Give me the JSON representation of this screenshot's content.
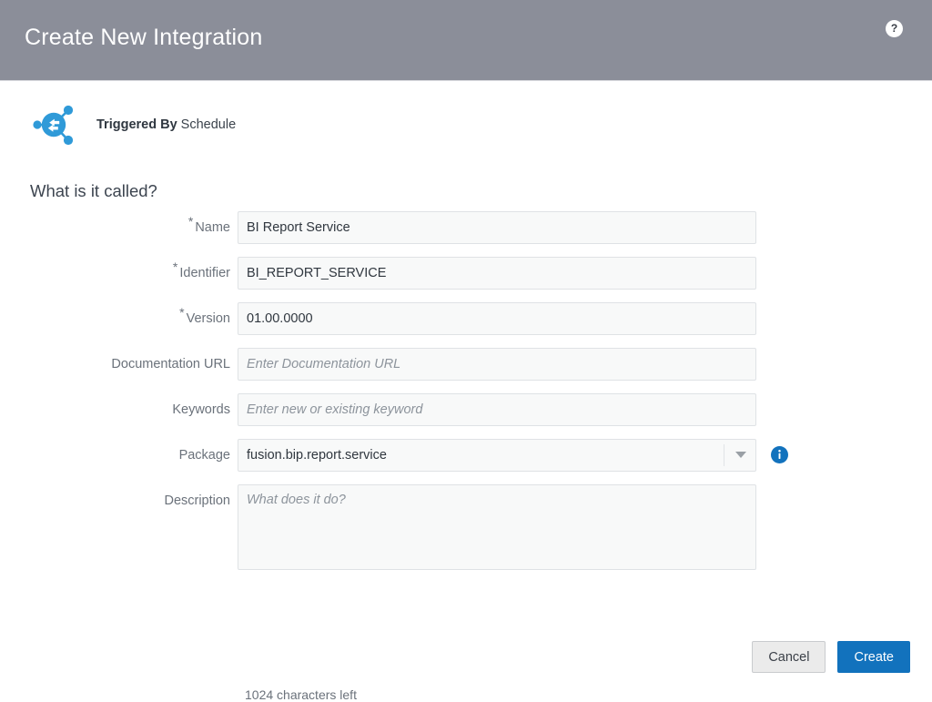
{
  "window": {
    "title": "Create New Integration",
    "help_icon": "question-mark-icon",
    "help_label": "?",
    "header_bg": "#8b8e99"
  },
  "trigger": {
    "icon": "integration-trigger-icon",
    "prefix": "Triggered By",
    "value": "Schedule",
    "accent": "#2f9ad8"
  },
  "section": {
    "heading": "What is it called?"
  },
  "fields": {
    "name": {
      "label": "Name",
      "required": true,
      "required_marker": "*",
      "value": "BI Report Service",
      "placeholder": ""
    },
    "identifier": {
      "label": "Identifier",
      "required": true,
      "required_marker": "*",
      "value": "BI_REPORT_SERVICE",
      "placeholder": ""
    },
    "version": {
      "label": "Version",
      "required": true,
      "required_marker": "*",
      "value": "01.00.0000",
      "placeholder": ""
    },
    "documentation_url": {
      "label": "Documentation URL",
      "required": false,
      "value": "",
      "placeholder": "Enter Documentation URL"
    },
    "keywords": {
      "label": "Keywords",
      "required": false,
      "value": "",
      "placeholder": "Enter new or existing keyword"
    },
    "package": {
      "label": "Package",
      "required": false,
      "value": "fusion.bip.report.service",
      "placeholder": "",
      "options": [
        "fusion.bip.report.service"
      ],
      "dropdown_icon": "chevron-down-icon",
      "info_icon": "info-icon",
      "info_accent": "#1272bd"
    },
    "description": {
      "label": "Description",
      "required": false,
      "value": "",
      "placeholder": "What does it do?",
      "char_counter": "1024 characters left"
    }
  },
  "footer": {
    "cancel_label": "Cancel",
    "create_label": "Create",
    "primary_color": "#1272bd"
  }
}
